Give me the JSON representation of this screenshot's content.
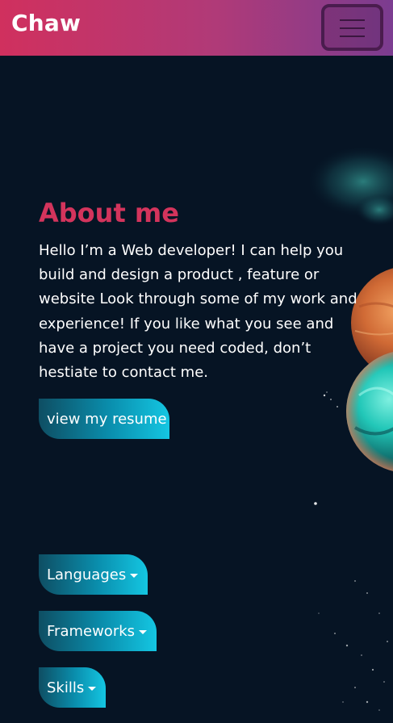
{
  "navbar": {
    "brand": "Chaw",
    "menu_icon": "hamburger-icon"
  },
  "about": {
    "title": "About me",
    "body": "Hello I’m a Web developer! I can help you build and design a product , feature or website Look through some of my work and experience! If you like what you see and have a project you need coded, don’t hestiate to contact me.",
    "resume_label": "view my resume"
  },
  "dropdowns": {
    "languages": "Languages",
    "frameworks": "Frameworks",
    "skills": "Skills",
    "caret_icon": "caret-down-icon"
  },
  "colors": {
    "background": "#061424",
    "nav_gradient_start": "#d0305e",
    "nav_gradient_end": "#7b3c90",
    "title": "#d3345c",
    "pill_gradient_start": "#0e4e63",
    "pill_gradient_end": "#14c6e2"
  }
}
